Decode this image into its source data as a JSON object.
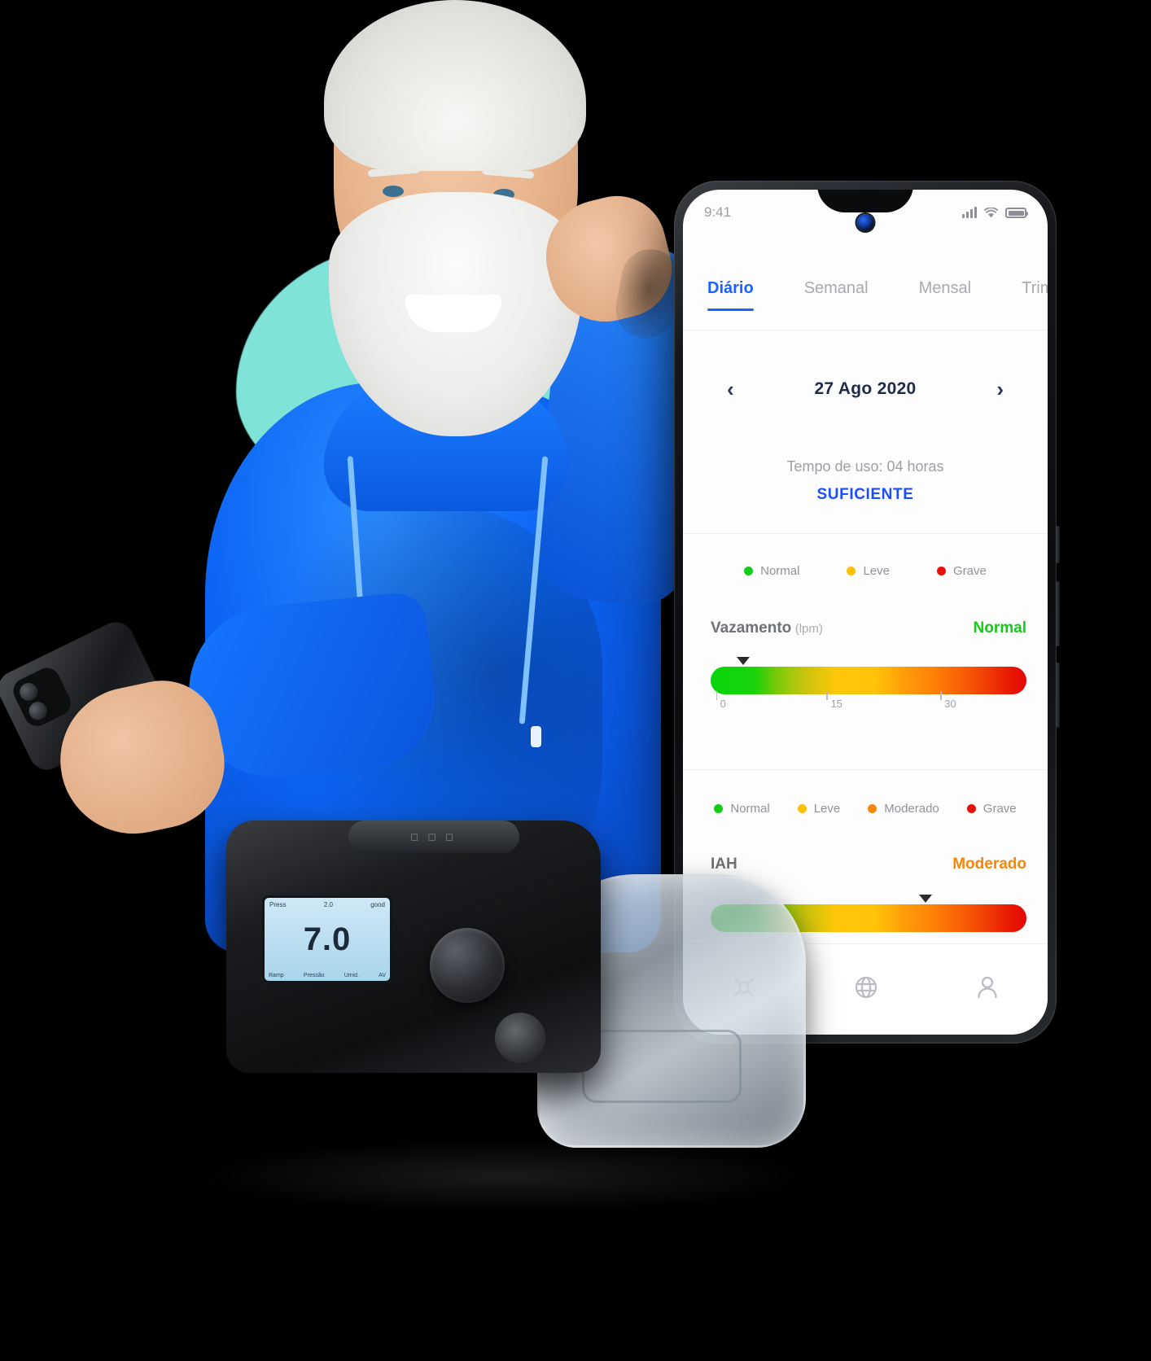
{
  "phone": {
    "status": {
      "time": "9:41",
      "signal_icon": "cellular-signal-icon",
      "wifi_icon": "wifi-icon",
      "battery_icon": "battery-icon"
    },
    "tabs": [
      {
        "label": "Diário",
        "active": true
      },
      {
        "label": "Semanal",
        "active": false
      },
      {
        "label": "Mensal",
        "active": false
      },
      {
        "label": "Trimestral",
        "active": false
      }
    ],
    "date_nav": {
      "prev_icon": "chevron-left-icon",
      "next_icon": "chevron-right-icon",
      "date": "27 Ago 2020"
    },
    "usage": {
      "text": "Tempo de uso: 04 horas",
      "status": "SUFICIENTE",
      "status_color": "#1b4dff"
    },
    "legend_3": [
      {
        "label": "Normal",
        "color": "#12cc17"
      },
      {
        "label": "Leve",
        "color": "#ffc107"
      },
      {
        "label": "Grave",
        "color": "#e4120a"
      }
    ],
    "legend_4": [
      {
        "label": "Normal",
        "color": "#12cc17"
      },
      {
        "label": "Leve",
        "color": "#ffc107"
      },
      {
        "label": "Moderado",
        "color": "#fb8507"
      },
      {
        "label": "Grave",
        "color": "#e4120a"
      }
    ],
    "metrics": [
      {
        "name": "Vazamento",
        "unit": "(lpm)",
        "value_label": "Normal",
        "value_color": "#12cc17",
        "marker_pct": 8,
        "ticks": [
          "0",
          "15",
          "30"
        ],
        "tick_pct": [
          3,
          38,
          74
        ]
      },
      {
        "name": "IAH",
        "unit": "",
        "value_label": "Moderado",
        "value_color": "#fb8507",
        "marker_pct": 69,
        "ticks": [],
        "tick_pct": []
      }
    ],
    "bottom_nav": [
      {
        "icon": "mask-icon"
      },
      {
        "icon": "globe-icon"
      },
      {
        "icon": "person-icon"
      }
    ]
  },
  "device": {
    "brand_top": "□ □ □",
    "screen_value": "7.0",
    "screen_top_left": "Press",
    "screen_top_right": "good",
    "screen_sub": "2.0",
    "screen_bottom": [
      "Ramp",
      "Pressão",
      "Umid.",
      "AV"
    ],
    "knob_icon": "control-knob-icon",
    "logo_icon": "brand-logo-icon"
  },
  "scene": {
    "blob_color": "#7fe3d8",
    "hoodie_color": "#0b64f4",
    "background": "#000000"
  }
}
